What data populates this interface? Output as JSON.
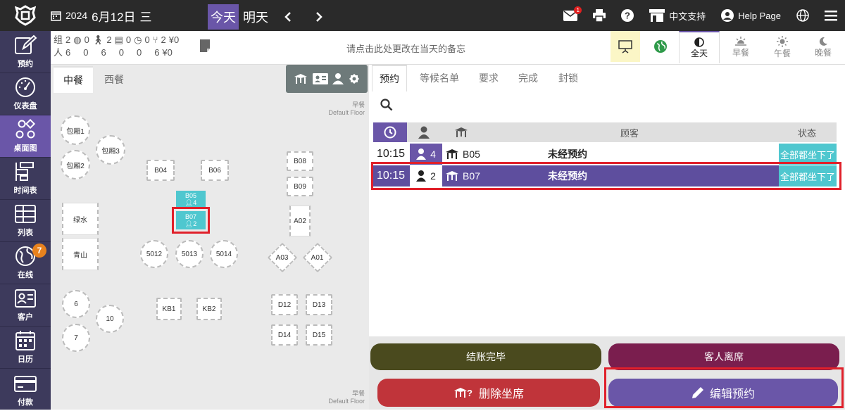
{
  "header": {
    "year": "2024",
    "date": "6月12日",
    "weekday": "三",
    "today_label": "今天",
    "tomorrow_label": "明天",
    "message_badge": "1",
    "language_label": "中文支持",
    "help_label": "Help Page"
  },
  "sidebar": {
    "items": [
      {
        "label": "预约",
        "icon": "edit-icon"
      },
      {
        "label": "仪表盘",
        "icon": "dashboard-icon"
      },
      {
        "label": "桌面图",
        "icon": "floor-map-icon"
      },
      {
        "label": "时间表",
        "icon": "timeline-icon"
      },
      {
        "label": "列表",
        "icon": "table-icon"
      },
      {
        "label": "在线",
        "icon": "globe-icon"
      },
      {
        "label": "客户",
        "icon": "customer-card-icon"
      },
      {
        "label": "日历",
        "icon": "calendar-icon"
      },
      {
        "label": "付款",
        "icon": "card-icon"
      }
    ],
    "online_badge": "7"
  },
  "stats": {
    "row1": [
      {
        "label": "组",
        "value": "2"
      },
      {
        "value": "0"
      },
      {
        "value": "2"
      },
      {
        "value": "0"
      },
      {
        "value": "0"
      },
      {
        "value": "2"
      },
      {
        "value": "¥0"
      }
    ],
    "row2": [
      {
        "label": "人",
        "value": "6"
      },
      {
        "value": "0"
      },
      {
        "value": "6"
      },
      {
        "value": "0"
      },
      {
        "value": "0"
      },
      {
        "value": "6"
      },
      {
        "value": "¥0"
      }
    ]
  },
  "memo_placeholder": "请点击此处更改在当天的备忘",
  "meal_tabs": [
    {
      "label": "全天",
      "active": true
    },
    {
      "label": "早餐",
      "active": false
    },
    {
      "label": "午餐",
      "active": false
    },
    {
      "label": "晚餐",
      "active": false
    }
  ],
  "floor_tabs": [
    "中餐",
    "西餐"
  ],
  "floor_label_top": {
    "meal": "早餐",
    "floor": "Default Floor"
  },
  "floor_label_bottom": {
    "meal": "早餐",
    "floor": "Default Floor"
  },
  "tables": {
    "baoxiang1": "包厢1",
    "baoxiang2": "包厢2",
    "baoxiang3": "包厢3",
    "b04": "B04",
    "b06": "B06",
    "b08": "B08",
    "b09": "B09",
    "b05": "B05",
    "b05_guests": "4",
    "b07": "B07",
    "b07_guests": "2",
    "lvshui": "绿水",
    "qingshan": "青山",
    "t5012": "5012",
    "t5013": "5013",
    "t5014": "5014",
    "a02": "A02",
    "a03": "A03",
    "a01": "A01",
    "t6": "6",
    "t7": "7",
    "t10": "10",
    "kb1": "KB1",
    "kb2": "KB2",
    "d12": "D12",
    "d13": "D13",
    "d14": "D14",
    "d15": "D15"
  },
  "right_tabs": [
    "预约",
    "等候名单",
    "要求",
    "完成",
    "封锁"
  ],
  "table_headers": {
    "customer": "顾客",
    "status": "状态"
  },
  "reservations": [
    {
      "time": "10:15",
      "guests": "4",
      "table": "B05",
      "customer": "未经预约",
      "status": "全部都坐下了",
      "selected": false
    },
    {
      "time": "10:15",
      "guests": "2",
      "table": "B07",
      "customer": "未经预约",
      "status": "全部都坐下了",
      "selected": true
    }
  ],
  "actions": {
    "checkout": "结账完毕",
    "leave": "客人离席",
    "delete_seat": "删除坐席",
    "edit": "编辑预约"
  },
  "colors": {
    "purple": "#6a56a8",
    "teal": "#4fc7cf",
    "olive": "#4a4a1e",
    "maroon": "#7a1e4e",
    "red": "#c0343a"
  }
}
